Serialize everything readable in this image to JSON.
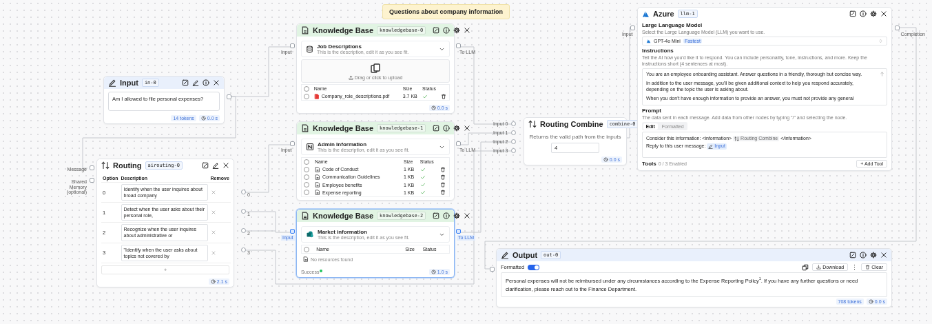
{
  "note": {
    "text": "Questions about company information"
  },
  "input_node": {
    "title": "Input",
    "id": "in-0",
    "value": "Am I allowed to file personal expenses?",
    "tokens": "14 tokens",
    "time": "0.0 s"
  },
  "routing_node": {
    "title": "Routing",
    "id": "airouting-0",
    "inputs": [
      "Message",
      "Shared Memory (optional)"
    ],
    "columns": [
      "Option",
      "Description",
      "Remove"
    ],
    "options": [
      {
        "option": "0",
        "description": "Identify when the user inquires about broad company"
      },
      {
        "option": "1",
        "description": "Detect when the user asks about their personal role,"
      },
      {
        "option": "2",
        "description": "Recognize when the user inquires about administrative or"
      },
      {
        "option": "3",
        "description": "\"Identify when the user asks about topics not covered by"
      }
    ],
    "outputs": [
      "0",
      "1",
      "2",
      "3"
    ],
    "add_label": "+",
    "time": "2.1 s"
  },
  "knowledge_bases": [
    {
      "title": "Knowledge Base",
      "id": "knowledgebase-0",
      "selected": false,
      "input_label": "Input",
      "output_label": "To LLM",
      "source": {
        "kind": "database",
        "name": "Job Descriptions",
        "description": "This is the description, edit it as you see fit."
      },
      "upload": "Drag or click to upload",
      "all_checked": false,
      "columns": [
        "Name",
        "Size",
        "Status"
      ],
      "files": [
        {
          "name": "Company_role_descriptions.pdf",
          "kind": "pdf",
          "size": "3.7 KB",
          "indexed": true,
          "checked": false
        }
      ],
      "time": "0.0 s"
    },
    {
      "title": "Knowledge Base",
      "id": "knowledgebase-1",
      "selected": false,
      "input_label": "Input",
      "output_label": "To LLM",
      "source": {
        "kind": "notion",
        "name": "Admin Information",
        "description": "This is the description, edit it as you see fit."
      },
      "all_checked": false,
      "columns": [
        "Name",
        "Size",
        "Status"
      ],
      "files": [
        {
          "name": "Code of Conduct",
          "kind": "doc",
          "size": "1 KB",
          "indexed": true,
          "checked": false
        },
        {
          "name": "Communication Guidelines",
          "kind": "doc",
          "size": "1 KB",
          "indexed": true,
          "checked": false
        },
        {
          "name": "Employee benefits",
          "kind": "doc",
          "size": "1 KB",
          "indexed": true,
          "checked": false
        },
        {
          "name": "Expense reporting",
          "kind": "doc",
          "size": "1 KB",
          "indexed": true,
          "checked": false
        }
      ]
    },
    {
      "title": "Knowledge Base",
      "id": "knowledgebase-2",
      "selected": true,
      "input_label": "Input",
      "output_label": "To LLM",
      "source": {
        "kind": "sharepoint",
        "name": "Market information",
        "description": "This is the description, edit it as you see fit."
      },
      "all_checked": false,
      "columns": [
        "Name",
        "Size",
        "Status"
      ],
      "empty": "No resources found",
      "status": "Success",
      "time": "1.0 s"
    }
  ],
  "routing_combine": {
    "title": "Routing Combine",
    "id": "combine-0",
    "inputs": [
      "Input 0",
      "Input 1",
      "Input 2",
      "Input 3"
    ],
    "description": "Returns the valid path from the inputs",
    "value": "4",
    "time": "0.0 s"
  },
  "llm_node": {
    "title": "Azure",
    "id": "llm-1",
    "input_label": "Input",
    "output_label": "Completion",
    "model_section": {
      "label": "Large Language Model",
      "hint": "Select the Large Language Model (LLM) you want to use.",
      "model": "GPT-4o Mini",
      "badge": "Fastest"
    },
    "instructions": {
      "label": "Instructions",
      "hint": "Tell the AI how you'd like it to respond. You can include personality, tone, instructions, and more. Keep the instructions short (4 sentences at most).",
      "paragraphs": [
        "You are an employee onboarding assistant. Answer questions in a friendly, thorough but concise way.",
        "In addition to the user message, you'll be given additional context to help you respond accurately, depending on the topic the user is asking about.",
        "When you don't have enough information to provide an answer, you must not provide any general"
      ]
    },
    "prompt": {
      "label": "Prompt",
      "hint": "The data sent in each message. Add data from other nodes by typing \"/\" and selecting the node.",
      "tabs": [
        {
          "label": "Edit",
          "selected": true
        },
        {
          "label": "Formatted",
          "selected": false
        }
      ],
      "lines": [
        {
          "segments": [
            {
              "kind": "text",
              "text": "Consider this information: <information>"
            },
            {
              "kind": "routing_ref",
              "text": "Routing Combine"
            },
            {
              "kind": "text",
              "text": "</information>"
            }
          ]
        },
        {
          "segments": [
            {
              "kind": "text",
              "text": "Reply to this user message:"
            },
            {
              "kind": "input_ref",
              "text": "Input"
            }
          ]
        }
      ]
    },
    "tools": {
      "label": "Tools",
      "count": "0 / 3 Enabled",
      "button": "+ Add Tool"
    }
  },
  "output_node": {
    "title": "Output",
    "id": "out-0",
    "formatted": {
      "label": "Formatted",
      "on": true
    },
    "download": "Download",
    "more": "⋮",
    "clear": "Clear",
    "text": "Personal expenses will not be reimbursed under any circumstances according to the Expense Reporting Policy$^{1}$. If you have any further questions or need clarification, please reach out to the Finance Department.",
    "tokens": "708 tokens",
    "time": "0.0 s"
  }
}
